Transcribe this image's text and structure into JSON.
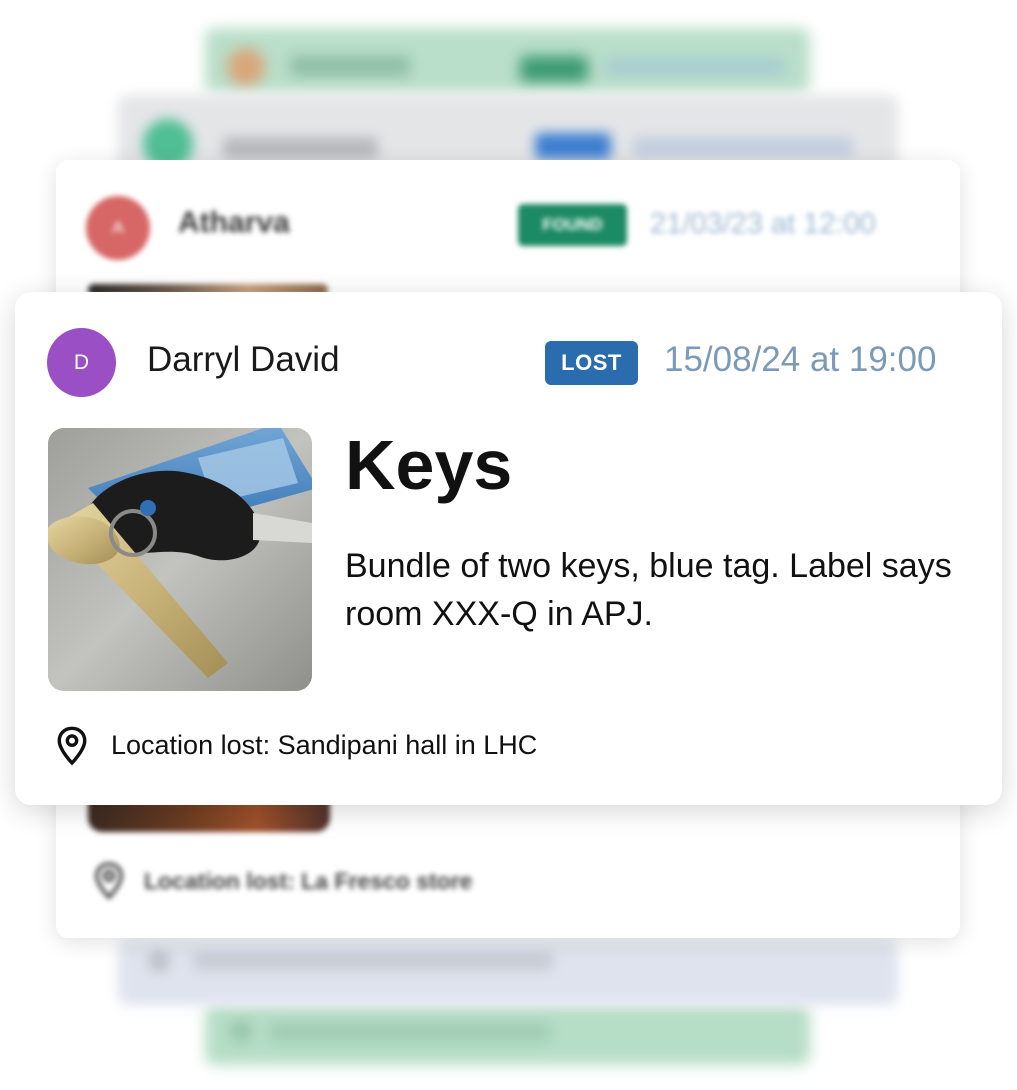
{
  "posts": {
    "front": {
      "avatar_initial": "D",
      "author": "Darryl David",
      "status": "LOST",
      "datetime": "15/08/24 at 19:00",
      "title": "Keys",
      "description": "Bundle of two keys, blue tag. Label says room XXX-Q in APJ.",
      "location": "Location lost: Sandipani hall in LHC",
      "colors": {
        "avatar": "#9a4fc5",
        "badge": "#2a6cae",
        "date": "#7b9ab7"
      }
    },
    "middle": {
      "avatar_initial": "A",
      "author": "Atharva",
      "status": "FOUND",
      "datetime": "21/03/23 at 12:00",
      "location": "Location lost: La Fresco store",
      "colors": {
        "avatar": "#d76767",
        "badge": "#1c8a64",
        "date": "#9fb7d0"
      }
    }
  },
  "icons": {
    "location": "map-pin-icon"
  }
}
